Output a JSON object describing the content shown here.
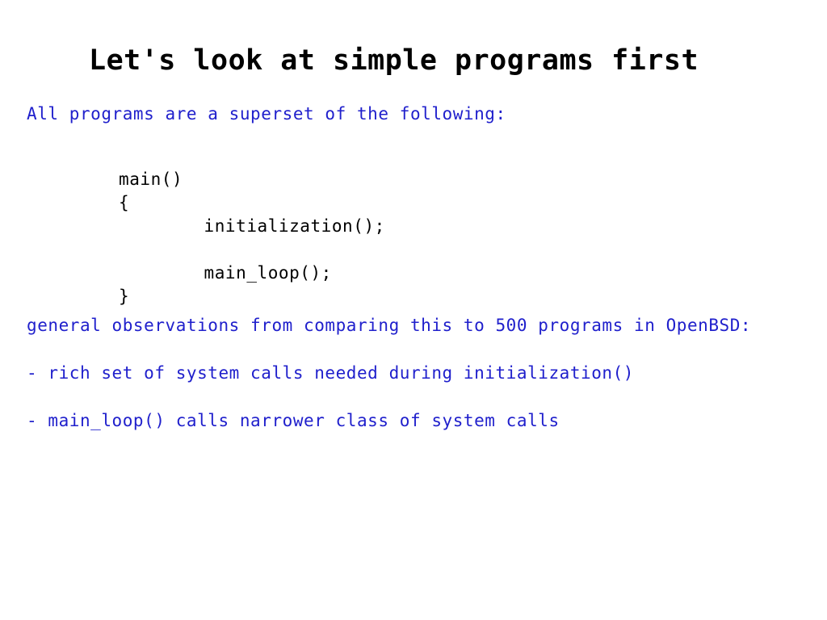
{
  "slide": {
    "title": "Let's look at simple programs first",
    "background_color": "#ffffff",
    "title_color": "#000000",
    "body_color": "#2020cc",
    "code_color": "#000000"
  },
  "body": {
    "intro": "All programs are a superset of the following:",
    "observations_heading": "general observations from comparing this to 500 programs in OpenBSD:",
    "bullets": [
      "- rich set of system calls needed during initialization()",
      "- main_loop() calls narrower class of system calls"
    ]
  },
  "code": {
    "lines": [
      "main()",
      "{",
      "        initialization();",
      "",
      "        main_loop();",
      "}"
    ]
  }
}
